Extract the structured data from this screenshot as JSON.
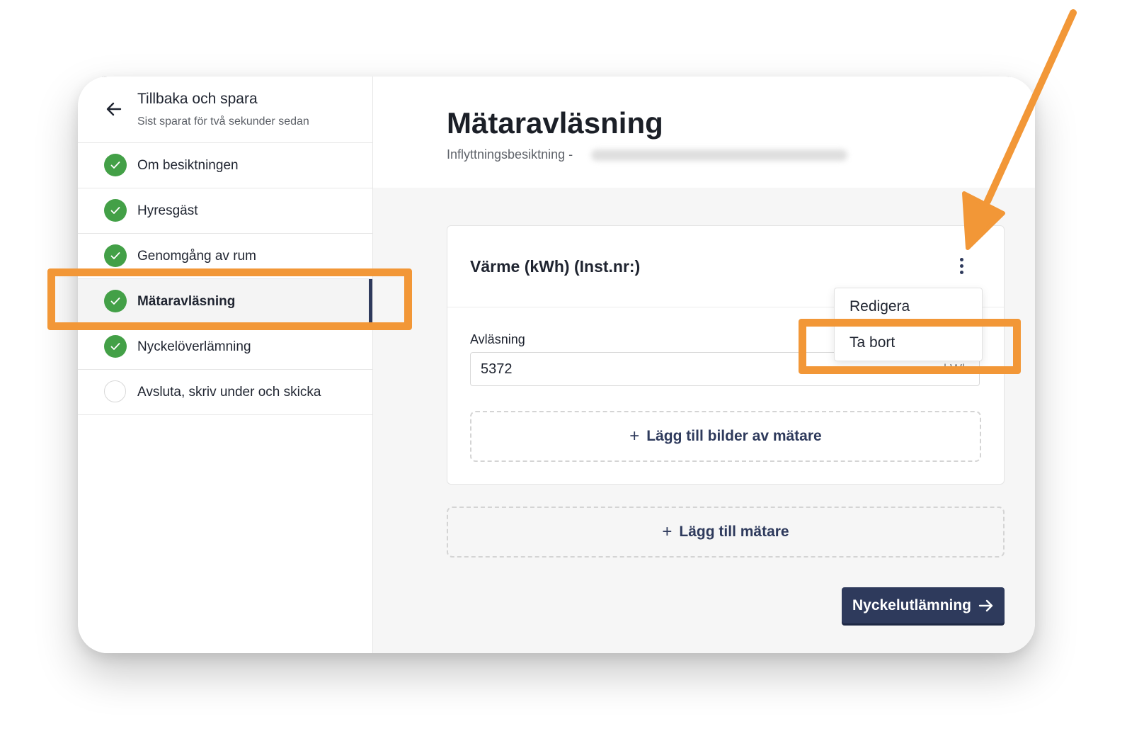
{
  "sidebar": {
    "back_title": "Tillbaka och spara",
    "back_subtitle": "Sist sparat för två sekunder sedan",
    "items": [
      {
        "label": "Om besiktningen",
        "status": "done",
        "active": false
      },
      {
        "label": "Hyresgäst",
        "status": "done",
        "active": false
      },
      {
        "label": "Genomgång av rum",
        "status": "done",
        "active": false
      },
      {
        "label": "Mätaravläsning",
        "status": "done",
        "active": true
      },
      {
        "label": "Nyckelöverlämning",
        "status": "done",
        "active": false
      },
      {
        "label": "Avsluta, skriv under och skicka",
        "status": "pending",
        "active": false
      }
    ]
  },
  "main": {
    "title": "Mätaravläsning",
    "subtitle": "Inflyttningsbesiktning -",
    "meter_card": {
      "title": "Värme (kWh) (Inst.nr:)",
      "reading_label": "Avläsning",
      "reading_value": "5372",
      "unit": "kWh",
      "add_images_label": "Lägg till bilder av mätare"
    },
    "menu": {
      "edit_label": "Redigera",
      "delete_label": "Ta bort"
    },
    "add_meter_label": "Lägg till mätare",
    "next_button_label": "Nyckelutlämning"
  },
  "colors": {
    "accent": "#2e3a5c",
    "success": "#43a047",
    "annotation": "#f29737"
  }
}
